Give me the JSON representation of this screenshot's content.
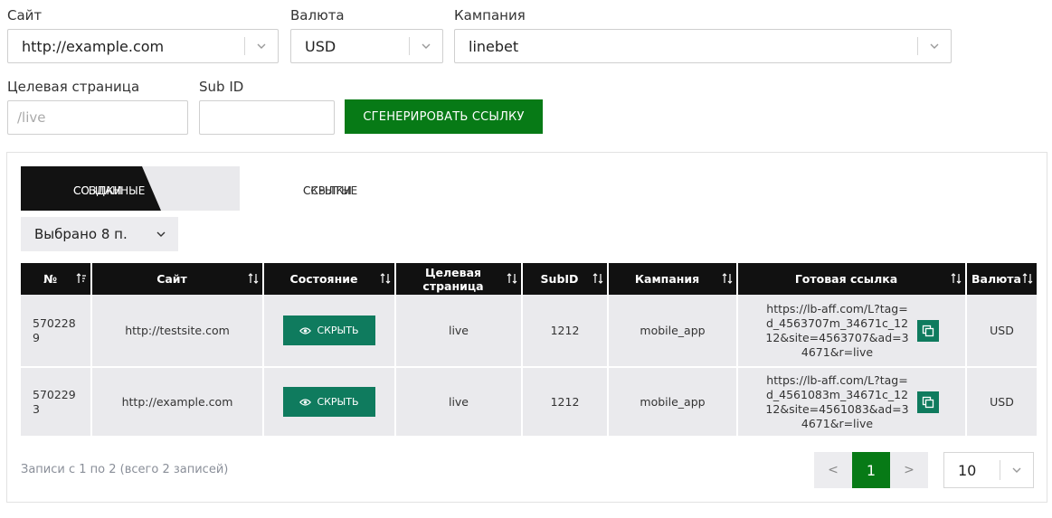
{
  "form": {
    "site": {
      "label": "Сайт",
      "value": "http://example.com"
    },
    "currency": {
      "label": "Валюта",
      "value": "USD"
    },
    "campaign": {
      "label": "Кампания",
      "value": "linebet"
    },
    "landing": {
      "label": "Целевая страница",
      "placeholder": "/live",
      "value": ""
    },
    "subid": {
      "label": "Sub ID",
      "value": ""
    },
    "generate_label": "СГЕНЕРИРОВАТЬ ССЫЛКУ"
  },
  "tabs": [
    {
      "label_line1": "СОЗДАННЫЕ",
      "label_line2": "ССЫЛКИ",
      "active": true
    },
    {
      "label_line1": "СКРЫТЫЕ",
      "label_line2": "ССЫЛКИ",
      "active": false
    }
  ],
  "column_select": {
    "label": "Выбрано 8 п."
  },
  "table": {
    "headers": [
      "№",
      "Сайт",
      "Состояние",
      "Целевая страница",
      "SubID",
      "Кампания",
      "Готовая ссылка",
      "Валюта"
    ],
    "rows": [
      {
        "id_line1": "570228",
        "id_line2": "9",
        "site": "http://testsite.com",
        "action_label": "СКРЫТЬ",
        "landing": "live",
        "subid": "1212",
        "campaign": "mobile_app",
        "link": "https://lb-aff.com/L?tag=d_4563707m_34671c_1212&site=4563707&ad=34671&r=live",
        "currency": "USD"
      },
      {
        "id_line1": "570229",
        "id_line2": "3",
        "site": "http://example.com",
        "action_label": "СКРЫТЬ",
        "landing": "live",
        "subid": "1212",
        "campaign": "mobile_app",
        "link": "https://lb-aff.com/L?tag=d_4561083m_34671c_1212&site=4561083&ad=34671&r=live",
        "currency": "USD"
      }
    ]
  },
  "footer": {
    "info": "Записи с 1 по 2 (всего 2 записей)",
    "prev": "<",
    "current_page": "1",
    "next": ">",
    "page_size": "10"
  },
  "colors": {
    "primary_green": "#077a16",
    "action_teal": "#0f7b5e",
    "header_black": "#111111",
    "row_gray": "#eaeaed"
  },
  "icons": [
    "chevron-down-icon",
    "sort-icon",
    "eye-icon",
    "copy-icon"
  ]
}
